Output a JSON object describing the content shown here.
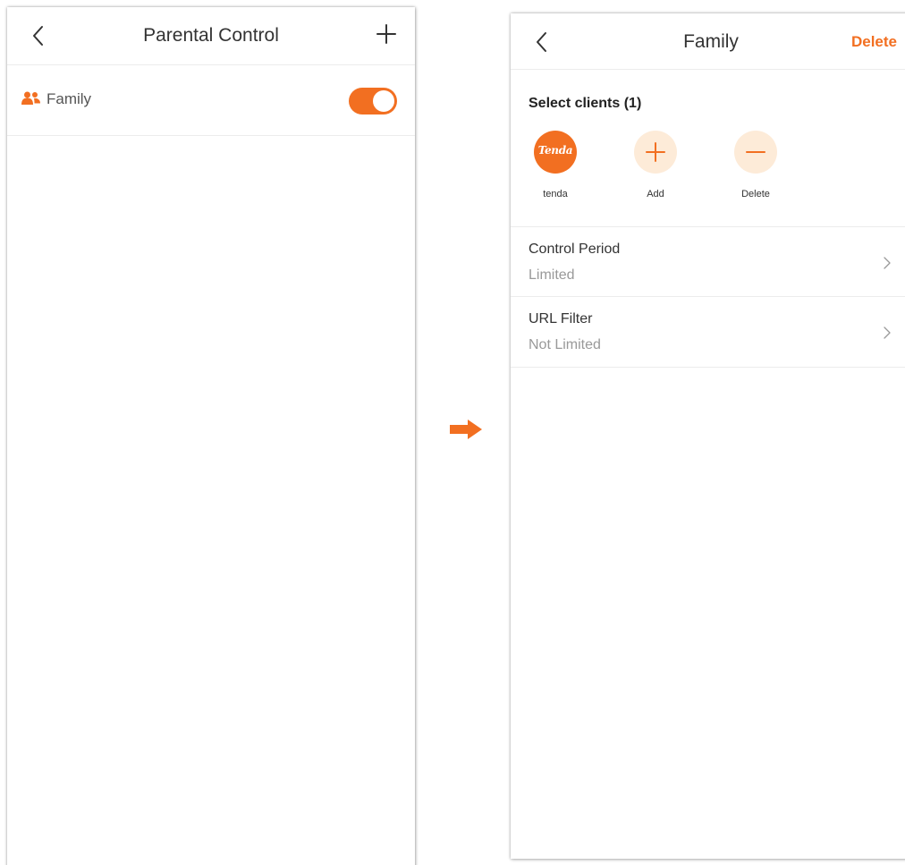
{
  "colors": {
    "accent": "#f26f21",
    "accent_light": "#fdebd8",
    "text_primary": "#333333",
    "text_secondary": "#999999",
    "divider": "#ececec"
  },
  "parental_control_screen": {
    "title": "Parental Control",
    "back_icon": "chevron-left-icon",
    "add_icon": "plus-icon",
    "groups": [
      {
        "name": "Family",
        "icon": "users-icon",
        "enabled": true
      }
    ]
  },
  "flow_arrow_icon": "arrow-right-icon",
  "family_screen": {
    "title": "Family",
    "back_icon": "chevron-left-icon",
    "delete_action": "Delete",
    "select_clients_label": "Select clients (1)",
    "clients": [
      {
        "label": "tenda",
        "logo_text": "Tenda"
      }
    ],
    "add_label": "Add",
    "remove_label": "Delete",
    "settings": [
      {
        "title": "Control Period",
        "value": "Limited",
        "icon": "chevron-right-icon"
      },
      {
        "title": "URL Filter",
        "value": "Not Limited",
        "icon": "chevron-right-icon"
      }
    ]
  }
}
